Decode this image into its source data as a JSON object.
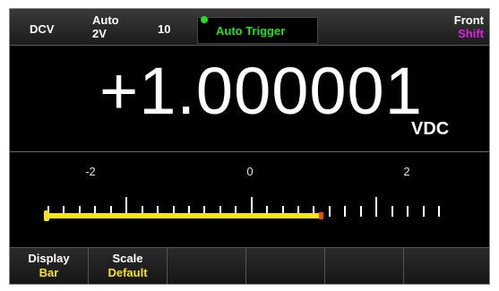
{
  "status": {
    "mode": "DCV",
    "range_auto": "Auto",
    "range_value": "2V",
    "digits": "10",
    "trigger": "Auto Trigger",
    "panel": "Front",
    "shift": "Shift"
  },
  "reading": {
    "value": "+1.000001",
    "unit": "VDC"
  },
  "bargraph": {
    "tick_labels": [
      "-2",
      "0",
      "2"
    ],
    "scale_min": -2.5,
    "scale_max": 2.5,
    "level": 1.000001
  },
  "softkeys": [
    {
      "title": "Display",
      "value": "Bar"
    },
    {
      "title": "Scale",
      "value": "Default"
    },
    {
      "title": "",
      "value": ""
    },
    {
      "title": "",
      "value": ""
    },
    {
      "title": "",
      "value": ""
    },
    {
      "title": "",
      "value": ""
    }
  ],
  "colors": {
    "trigger": "#22e022",
    "shift": "#e020e0",
    "softkey_value": "#f5e41d",
    "bar": "#f5e41d"
  }
}
